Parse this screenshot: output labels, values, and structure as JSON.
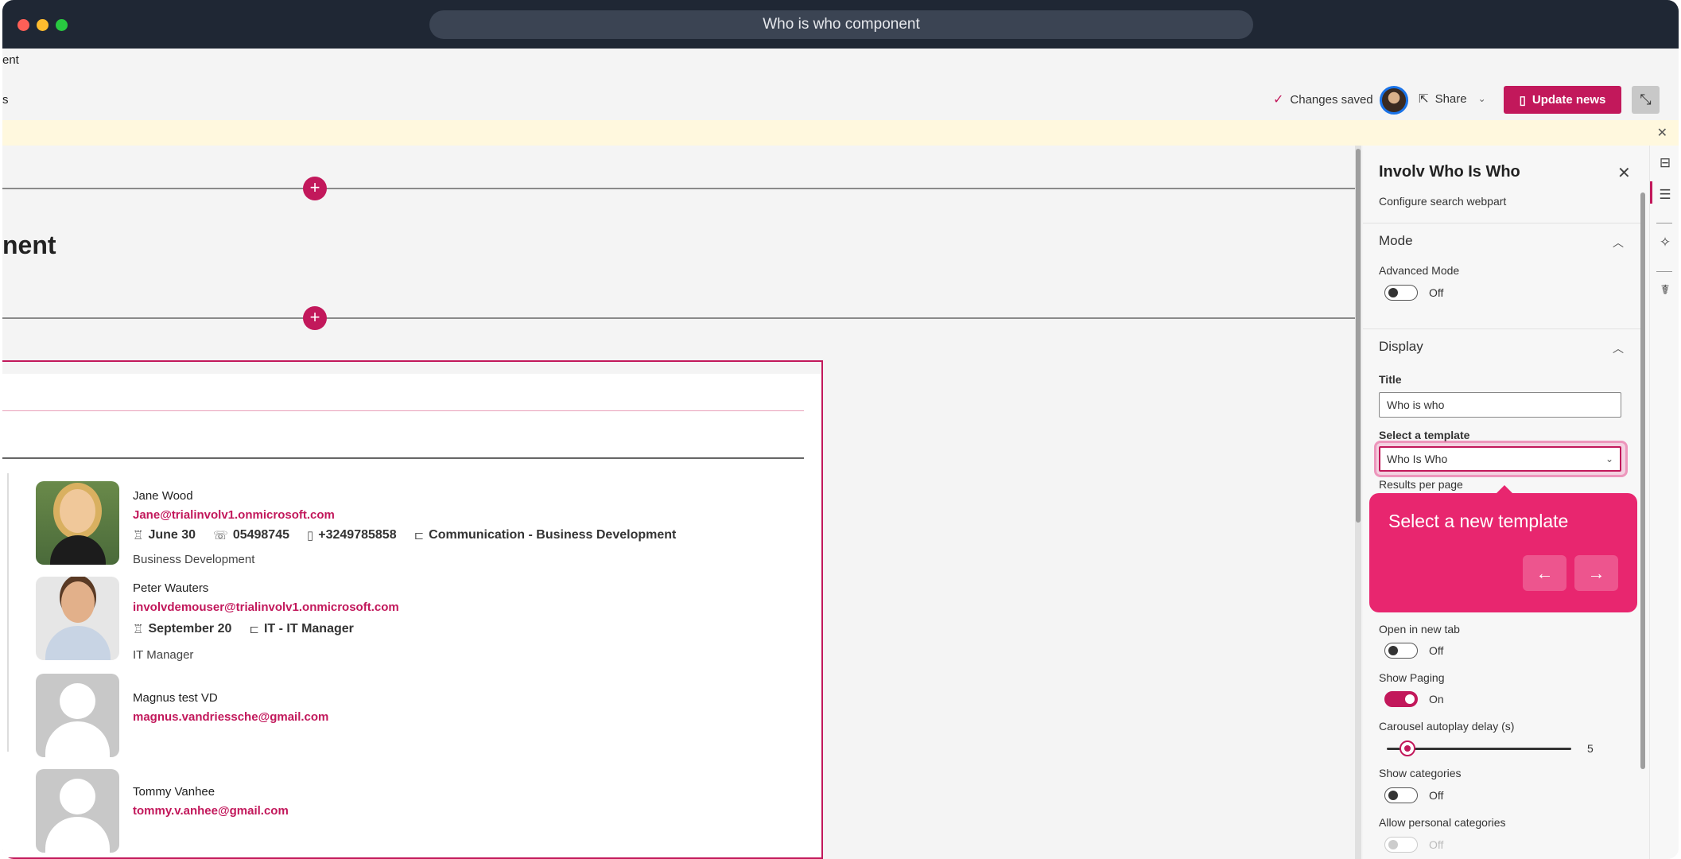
{
  "window": {
    "title": "Who is who component"
  },
  "breadcrumb": {
    "line1": "ent",
    "line2": "s"
  },
  "toolbar": {
    "changes_saved": "Changes saved",
    "share_label": "Share",
    "update_label": "Update news"
  },
  "page": {
    "heading": "nent"
  },
  "people": [
    {
      "name": "Jane Wood",
      "email": "Jane@trialinvolv1.onmicrosoft.com",
      "birthday": "June 30",
      "phone": "05498745",
      "mobile": "+3249785858",
      "department": "Communication - Business Development",
      "role": "Business Development"
    },
    {
      "name": "Peter Wauters",
      "email": "involvdemouser@trialinvolv1.onmicrosoft.com",
      "birthday": "September 20",
      "department": "IT - IT Manager",
      "role": "IT Manager"
    },
    {
      "name": "Magnus test VD",
      "email": "magnus.vandriessche@gmail.com"
    },
    {
      "name": "Tommy Vanhee",
      "email": "tommy.v.anhee@gmail.com"
    }
  ],
  "panel": {
    "title": "Involv Who Is Who",
    "subtitle": "Configure search webpart",
    "mode": {
      "title": "Mode",
      "advanced_label": "Advanced Mode",
      "advanced_state": "Off"
    },
    "display": {
      "title": "Display",
      "title_label": "Title",
      "title_value": "Who is who",
      "template_label": "Select a template",
      "template_value": "Who Is Who",
      "results_label": "Results per page",
      "open_new_tab_label": "Open in new tab",
      "open_new_tab_state": "Off",
      "show_paging_label": "Show Paging",
      "show_paging_state": "On",
      "carousel_label": "Carousel autoplay delay (s)",
      "carousel_value": "5",
      "show_categories_label": "Show categories",
      "show_categories_state": "Off",
      "personal_categories_label": "Allow personal categories",
      "personal_categories_state": "Off"
    }
  },
  "tooltip": {
    "text": "Select a new template"
  },
  "colors": {
    "accent": "#c2185b",
    "tooltip": "#e8266f",
    "titlebar": "#1f2734"
  }
}
